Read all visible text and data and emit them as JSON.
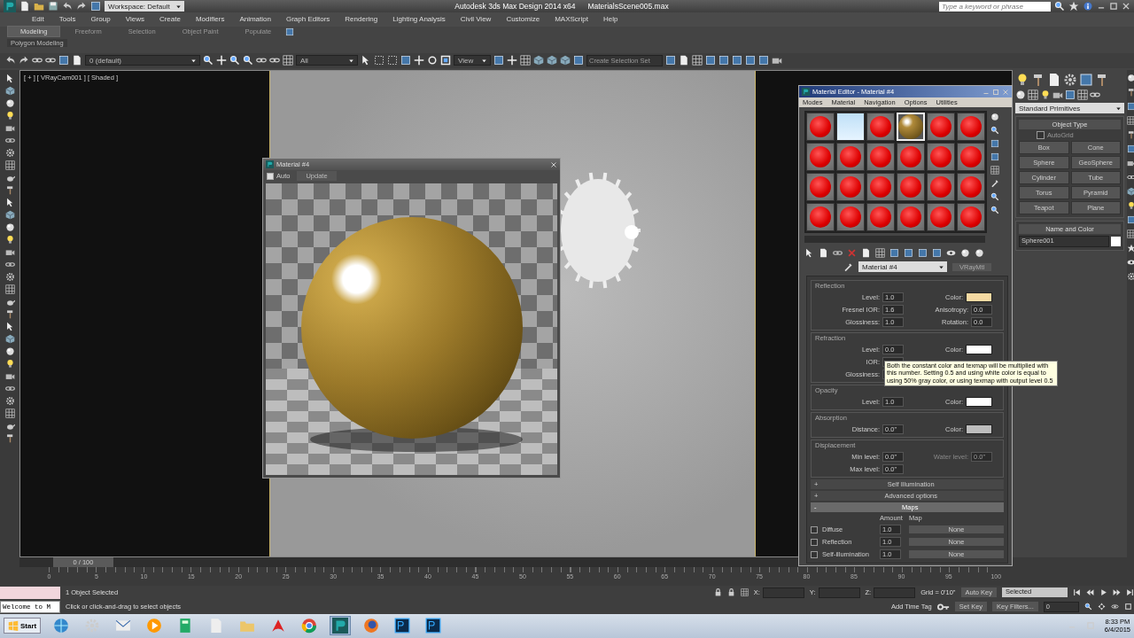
{
  "title_bar": {
    "workspace": "Workspace: Default",
    "app_title": "Autodesk 3ds Max Design 2014 x64",
    "file_name": "MaterialsScene005.max",
    "search": {
      "placeholder": "Type a keyword or phrase"
    }
  },
  "menu_bar": [
    "Edit",
    "Tools",
    "Group",
    "Views",
    "Create",
    "Modifiers",
    "Animation",
    "Graph Editors",
    "Rendering",
    "Lighting Analysis",
    "Civil View",
    "Customize",
    "MAXScript",
    "Help"
  ],
  "ribbon": {
    "tabs": [
      {
        "label": "Modeling",
        "selected": true
      },
      {
        "label": "Freeform",
        "selected": false
      },
      {
        "label": "Selection",
        "selected": false
      },
      {
        "label": "Object Paint",
        "selected": false
      },
      {
        "label": "Populate",
        "selected": false
      }
    ],
    "panel": "Polygon Modeling"
  },
  "main_toolbar": {
    "layer": "0 (default)",
    "selection_filter": "All",
    "reference_coord": "View",
    "selection_set": {
      "placeholder": "Create Selection Set"
    }
  },
  "viewport": {
    "label": "[ + ] [ VRayCam001 ] [ Shaded ]"
  },
  "render_window": {
    "title": "Material #4",
    "auto": {
      "label": "Auto",
      "checked": true
    },
    "update": "Update"
  },
  "material_editor": {
    "title": "Material Editor - Material #4",
    "menu": [
      "Modes",
      "Material",
      "Navigation",
      "Options",
      "Utilities"
    ],
    "slots": [
      {
        "kind": "vray",
        "selected": false
      },
      {
        "kind": "blank",
        "selected": false
      },
      {
        "kind": "vray",
        "selected": false
      },
      {
        "kind": "gold",
        "selected": true
      },
      {
        "kind": "vray",
        "selected": false
      },
      {
        "kind": "vray",
        "selected": false
      },
      {
        "kind": "vray",
        "selected": false
      },
      {
        "kind": "vray",
        "selected": false
      },
      {
        "kind": "vray",
        "selected": false
      },
      {
        "kind": "vray",
        "selected": false
      },
      {
        "kind": "vray",
        "selected": false
      },
      {
        "kind": "vray",
        "selected": false
      },
      {
        "kind": "vray",
        "selected": false
      },
      {
        "kind": "vray",
        "selected": false
      },
      {
        "kind": "vray",
        "selected": false
      },
      {
        "kind": "vray",
        "selected": false
      },
      {
        "kind": "vray",
        "selected": false
      },
      {
        "kind": "vray",
        "selected": false
      },
      {
        "kind": "vray",
        "selected": false
      },
      {
        "kind": "vray",
        "selected": false
      },
      {
        "kind": "vray",
        "selected": false
      },
      {
        "kind": "vray",
        "selected": false
      },
      {
        "kind": "vray",
        "selected": false
      },
      {
        "kind": "vray",
        "selected": false
      }
    ],
    "material_name": "Material #4",
    "material_type": "VRayMtl",
    "groups": [
      {
        "title": "Reflection",
        "rows": [
          [
            {
              "kind": "spinner",
              "label": "Level:",
              "value": "1.0",
              "disabled": false
            },
            {
              "kind": "color",
              "label": "Color:",
              "color": "#f5d9a2"
            }
          ],
          [
            {
              "kind": "spinner",
              "label": "Fresnel IOR:",
              "value": "1.6",
              "disabled": false
            },
            {
              "kind": "spinner",
              "label": "Anisotropy:",
              "value": "0.0",
              "disabled": false
            }
          ],
          [
            {
              "kind": "spinner",
              "label": "Glossiness:",
              "value": "1.0",
              "disabled": false
            },
            {
              "kind": "spinner",
              "label": "Rotation:",
              "value": "0.0",
              "disabled": false
            }
          ]
        ]
      },
      {
        "title": "Refraction",
        "rows": [
          [
            {
              "kind": "spinner",
              "label": "Level:",
              "value": "0.0",
              "disabled": false
            },
            {
              "kind": "color",
              "label": "Color:",
              "color": "#ffffff"
            }
          ],
          [
            {
              "kind": "spinner",
              "label": "IOR:"
            }
          ],
          [
            {
              "kind": "spinner",
              "label": "Glossiness:"
            }
          ]
        ]
      },
      {
        "title": "Opacity",
        "rows": [
          [
            {
              "kind": "spinner",
              "label": "Level:",
              "value": "1.0",
              "disabled": false
            },
            {
              "kind": "color",
              "label": "Color:",
              "color": "#ffffff"
            }
          ]
        ]
      },
      {
        "title": "Absorption",
        "rows": [
          [
            {
              "kind": "spinner",
              "label": "Distance:",
              "value": "0.0\"",
              "disabled": false
            },
            {
              "kind": "color",
              "label": "Color:",
              "color": "#bdbdbd"
            }
          ]
        ]
      },
      {
        "title": "Displacement",
        "rows": [
          [
            {
              "kind": "spinner",
              "label": "Min level:",
              "value": "0.0\"",
              "disabled": false
            },
            {
              "kind": "spinner",
              "label": "Water level:",
              "value": "0.0\"",
              "disabled": true
            }
          ],
          [
            {
              "kind": "spinner",
              "label": "Max level:",
              "value": "0.0\"",
              "disabled": false
            }
          ]
        ]
      }
    ],
    "tooltip": "Both the constant color and texmap will be multiplied with this number. Setting 0.5 and using white color is equal to using 50% gray color, or using texmap with output level 0.5",
    "rollouts": [
      {
        "toggle": "+",
        "label": "Self Illumination",
        "expanded": false
      },
      {
        "toggle": "+",
        "label": "Advanced options",
        "expanded": false
      },
      {
        "toggle": "-",
        "label": "Maps",
        "expanded": true
      }
    ],
    "maps": {
      "columns": [
        "Amount",
        "Map"
      ],
      "rows": [
        {
          "checked": false,
          "name": "Diffuse",
          "amount": "1.0",
          "map": "None"
        },
        {
          "checked": false,
          "name": "Reflection",
          "amount": "1.0",
          "map": "None"
        },
        {
          "checked": false,
          "name": "Self-illumination",
          "amount": "1.0",
          "map": "None"
        }
      ]
    }
  },
  "command_panel": {
    "category": "Standard Primitives",
    "object_type": "Object Type",
    "autogrid": {
      "label": "AutoGrid",
      "checked": false
    },
    "buttons": [
      "Box",
      "Cone",
      "Sphere",
      "GeoSphere",
      "Cylinder",
      "Tube",
      "Torus",
      "Pyramid",
      "Teapot",
      "Plane"
    ],
    "name_and_color": "Name and Color",
    "object_name": "Sphere001"
  },
  "timeline": {
    "frame": "0 / 100",
    "level": 0,
    "ticks": [
      "0",
      "5",
      "10",
      "15",
      "20",
      "25",
      "30",
      "35",
      "40",
      "45",
      "50",
      "55",
      "60",
      "65",
      "70",
      "75",
      "80",
      "85",
      "90",
      "95",
      "100"
    ]
  },
  "status_bar": {
    "maxscript_output": "Welcome to M",
    "selection": "1 Object Selected",
    "prompt": "Click or click-and-drag to select objects",
    "coords": [
      "X:",
      "Y:",
      "Z:"
    ],
    "grid": "Grid = 0'10\"",
    "add_time_tag": "Add Time Tag",
    "auto_key": "Auto Key",
    "key_mode": "Selected",
    "set_key": "Set Key",
    "key_filters": "Key Filters...",
    "frame": "0"
  },
  "taskbar": {
    "start": "Start",
    "time": "8:33 PM",
    "date": "6/4/2015"
  }
}
